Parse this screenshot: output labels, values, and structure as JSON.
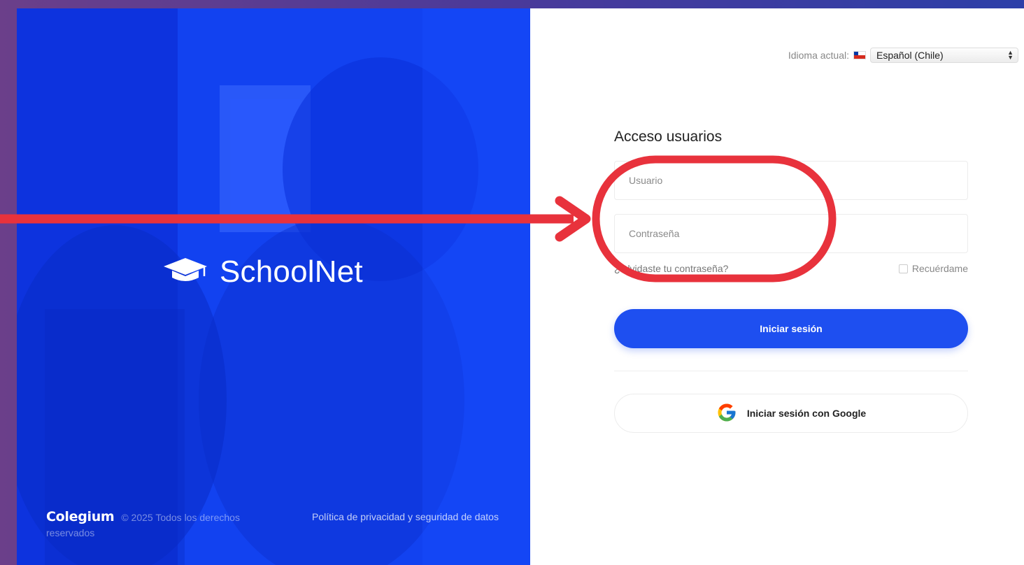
{
  "brand": {
    "name": "SchoolNet",
    "icon": "graduation-cap-icon"
  },
  "language": {
    "label": "Idioma actual:",
    "selected": "Español (Chile)",
    "flag": "chile-flag-icon"
  },
  "login": {
    "title": "Acceso usuarios",
    "username_placeholder": "Usuario",
    "password_placeholder": "Contraseña",
    "forgot_label": "¿Olvidaste tu contraseña?",
    "remember_label": "Recuérdame",
    "submit_label": "Iniciar sesión",
    "google_label": "Iniciar sesión con Google"
  },
  "footer": {
    "logo": "Colegium",
    "copyright": "© 2025  Todos los derechos reservados",
    "policy_label": "Política de privacidad y seguridad de datos"
  },
  "colors": {
    "primary": "#1e4ff0",
    "panel_blue": "#1242f0",
    "annotation_red": "#e8323c"
  }
}
